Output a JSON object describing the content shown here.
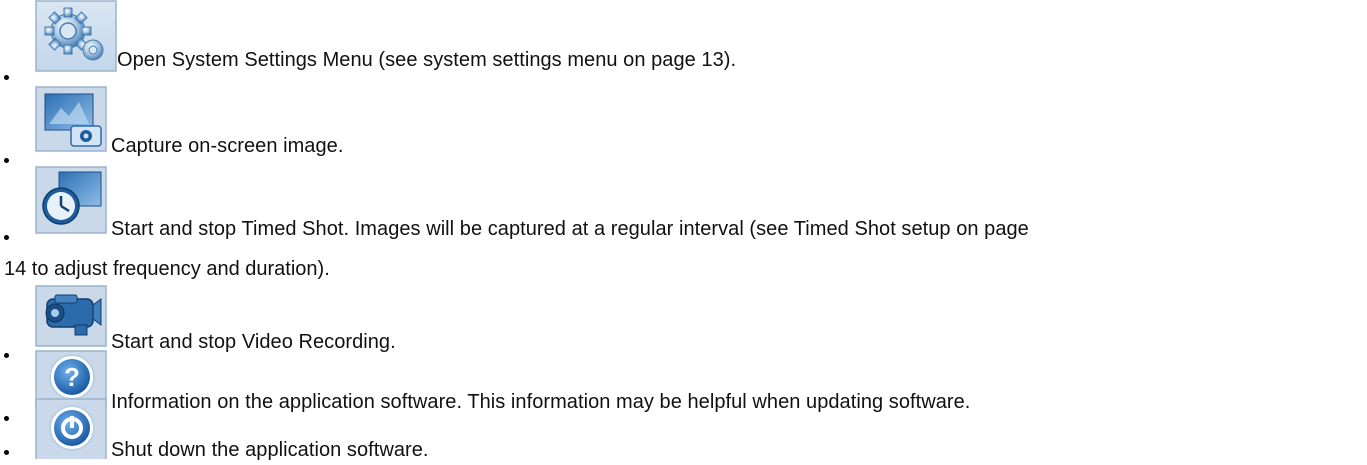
{
  "items": [
    {
      "icon": "settings-gear-icon",
      "text": "Open System Settings Menu (see system settings menu on page 13)."
    },
    {
      "icon": "capture-image-icon",
      "text": "Capture on-screen image."
    },
    {
      "icon": "timed-shot-clock-icon",
      "text": "Start and stop Timed Shot. Images will be captured at a regular interval (see Timed Shot setup on page",
      "text_continued": "14 to adjust frequency and duration)."
    },
    {
      "icon": "video-camera-icon",
      "text": "Start and stop Video Recording."
    },
    {
      "icon": "question-mark-icon",
      "text": "Information on the application software. This information may be helpful when updating software."
    },
    {
      "icon": "power-icon",
      "text": "Shut down the application software."
    }
  ]
}
